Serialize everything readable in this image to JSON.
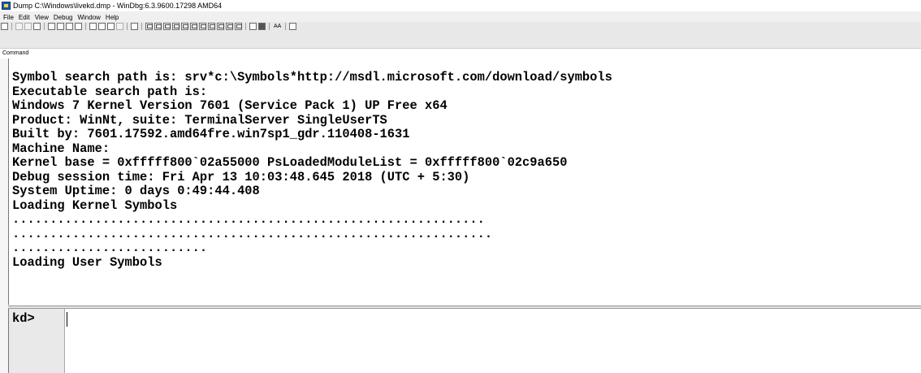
{
  "window": {
    "title": "Dump C:\\Windows\\livekd.dmp - WinDbg:6.3.9600.17298 AMD64"
  },
  "menu": [
    "File",
    "Edit",
    "View",
    "Debug",
    "Window",
    "Help"
  ],
  "toolbar": {
    "font_button_label": "AA"
  },
  "command_panel": {
    "label": "Command",
    "output_lines": [
      "Symbol search path is: srv*c:\\Symbols*http://msdl.microsoft.com/download/symbols",
      "Executable search path is:",
      "Windows 7 Kernel Version 7601 (Service Pack 1) UP Free x64",
      "Product: WinNt, suite: TerminalServer SingleUserTS",
      "Built by: 7601.17592.amd64fre.win7sp1_gdr.110408-1631",
      "Machine Name:",
      "Kernel base = 0xfffff800`02a55000 PsLoadedModuleList = 0xfffff800`02c9a650",
      "Debug session time: Fri Apr 13 10:03:48.645 2018 (UTC + 5:30)",
      "System Uptime: 0 days 0:49:44.408",
      "Loading Kernel Symbols",
      "...............................................................",
      "................................................................",
      "..........................",
      "Loading User Symbols"
    ],
    "prompt": "kd>",
    "input_value": ""
  }
}
